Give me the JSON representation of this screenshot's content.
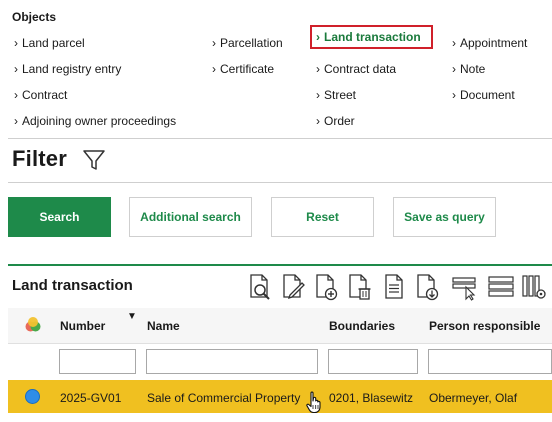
{
  "objects": {
    "title": "Objects",
    "links": [
      {
        "label": "Land parcel"
      },
      {
        "label": "Land registry entry"
      },
      {
        "label": "Contract"
      },
      {
        "label": "Adjoining owner proceedings"
      },
      {
        "label": "Parcellation"
      },
      {
        "label": "Certificate"
      },
      {
        "label": "Land transaction"
      },
      {
        "label": "Contract data"
      },
      {
        "label": "Street"
      },
      {
        "label": "Order"
      },
      {
        "label": "Appointment"
      },
      {
        "label": "Note"
      },
      {
        "label": "Document"
      }
    ],
    "chevron": "›"
  },
  "filter": {
    "title": "Filter",
    "buttons": {
      "search": "Search",
      "additional": "Additional search",
      "reset": "Reset",
      "save_query": "Save as query"
    }
  },
  "section": {
    "title": "Land transaction"
  },
  "table": {
    "headers": {
      "number": "Number",
      "name": "Name",
      "boundaries": "Boundaries",
      "person": "Person responsible"
    },
    "sort_indicator": "▼",
    "rows": [
      {
        "number": "2025-GV01",
        "name": "Sale of Commercial Property",
        "boundaries": "0201, Blasewitz",
        "person": "Obermeyer, Olaf"
      }
    ]
  },
  "colors": {
    "accent_green": "#1e8a4a",
    "selected_row": "#f0c020",
    "active_outline": "#d0202a"
  }
}
